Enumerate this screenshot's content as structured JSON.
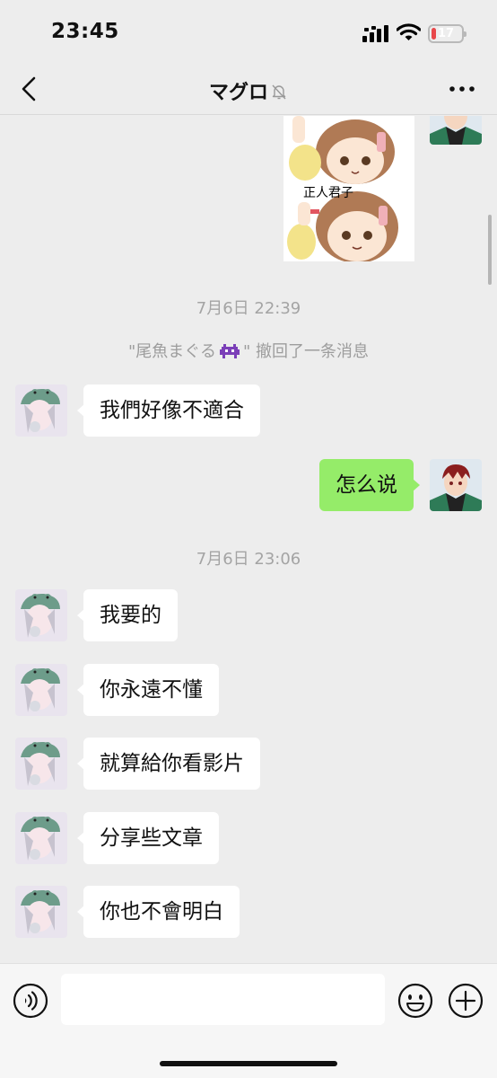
{
  "status_bar": {
    "time": "23:45",
    "battery": "17",
    "battery_level": 0.17
  },
  "header": {
    "title": "マグロ",
    "icons": {
      "back": "chevron-left-icon",
      "mute": "bell-slash-icon",
      "more": "more-horizontal-icon"
    }
  },
  "sticker": {
    "captions": [
      "正人君子"
    ]
  },
  "messages": [
    {
      "type": "timestamp",
      "text": "7月6日 22:39"
    },
    {
      "type": "system",
      "quoted_name": "\"尾魚まぐる",
      "suffix": "\" 撤回了一条消息"
    },
    {
      "type": "text",
      "side": "left",
      "text": "我們好像不適合"
    },
    {
      "type": "text",
      "side": "right",
      "text": "怎么说"
    },
    {
      "type": "timestamp",
      "text": "7月6日 23:06"
    },
    {
      "type": "text",
      "side": "left",
      "text": "我要的"
    },
    {
      "type": "text",
      "side": "left",
      "text": "你永遠不懂"
    },
    {
      "type": "text",
      "side": "left",
      "text": "就算給你看影片"
    },
    {
      "type": "text",
      "side": "left",
      "text": "分享些文章"
    },
    {
      "type": "text",
      "side": "left",
      "text": "你也不會明白"
    }
  ],
  "input_bar": {
    "placeholder": "",
    "value": "",
    "icons": {
      "voice": "voice-icon",
      "emoji": "smiley-icon",
      "plus": "plus-icon"
    }
  },
  "colors": {
    "background": "#ededed",
    "bubble_sent": "#95ec69",
    "bubble_received": "#ffffff",
    "battery_low": "#e8474a"
  }
}
